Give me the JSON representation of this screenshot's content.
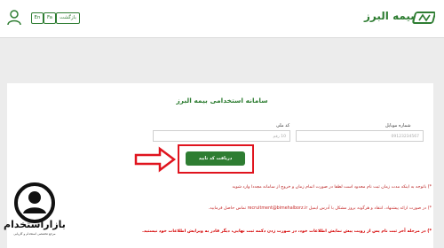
{
  "header": {
    "brand": "بیمه البرز",
    "back_label": "بازگشت",
    "lang_fa": "Fa",
    "lang_en": "En",
    "brand_color": "#2e7d32"
  },
  "form": {
    "title": "سامانه استخدامی بیمه البرز",
    "mobile_label": "شماره موبایل",
    "mobile_placeholder": "09123234567",
    "national_label": "کد ملی",
    "national_placeholder": "10 رقم",
    "submit_label": "دریافت کد تایید"
  },
  "notes": [
    "*) باتوجه به اینکه مدت زمان ثبت نام محدود است لطفا در صورت اتمام زمان و خروج از سامانه مجددا وارد شوید",
    "*) در صورت ارائه پیشنهاد، انتقاد و هرگونه بروز مشکل با آدرس ایمیل recruitment@bimehalborz.ir تماس حاصل فرمایید.",
    "*) در مرحله آخر ثبت نام پس از رویت پیش نمایش اطلاعات خود، در صورت زدن دکمه ثبت نهایی، دیگر قادر به ویرایش اطلاعات خود نیستید."
  ],
  "watermark": {
    "title": "بازاراستخدام",
    "subtitle": "مرجع تخصصی استخدام و کاریابی"
  },
  "colors": {
    "accent_red": "#e0141e",
    "green": "#2e7d32"
  }
}
